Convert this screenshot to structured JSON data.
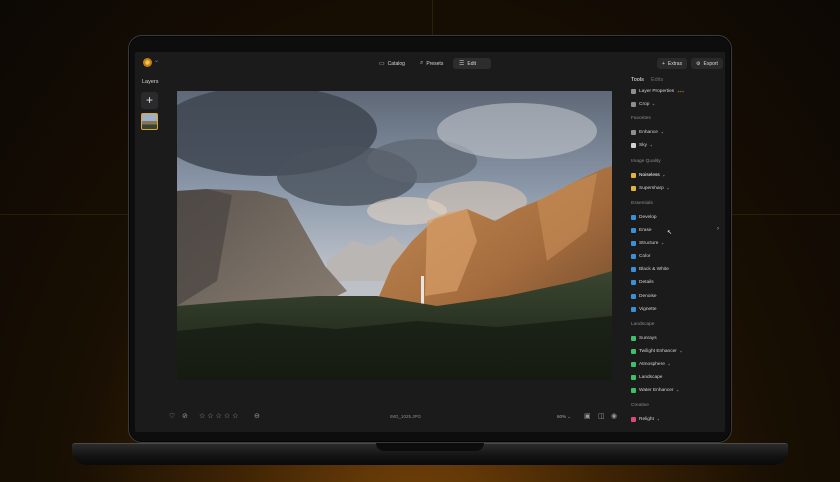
{
  "topbar": {
    "modes": [
      {
        "label": "Catalog",
        "icon": "catalog-icon"
      },
      {
        "label": "Presets",
        "icon": "presets-icon"
      },
      {
        "label": "Edit",
        "icon": "edit-icon",
        "active": true
      }
    ],
    "extras_label": "Extras",
    "export_label": "Export"
  },
  "layers": {
    "title": "Layers"
  },
  "bottombar": {
    "filename": "IMG_1025.JPG",
    "zoom": "60%",
    "rating_stars": 5
  },
  "right_panel": {
    "tabs": [
      "Tools",
      "Edits"
    ],
    "active_tab": "Tools",
    "top_tools": [
      {
        "label": "Layer Properties",
        "badge": "+++",
        "color": "#8e8e8e"
      },
      {
        "label": "Crop",
        "badge": "+",
        "color": "#8e8e8e"
      }
    ],
    "sections": [
      {
        "title": "Favorites",
        "tools": [
          {
            "label": "Enhance",
            "badge": "+",
            "color": "#8e8e8e"
          },
          {
            "label": "Sky",
            "badge": "+",
            "color": "#d0d0d0"
          }
        ]
      },
      {
        "title": "Image Quality",
        "tools": [
          {
            "label": "Noiseless",
            "badge": "+",
            "color": "#e0b43a",
            "selected": true
          },
          {
            "label": "Supersharp",
            "badge": "+",
            "color": "#e0b43a"
          }
        ]
      },
      {
        "title": "Essentials",
        "tools": [
          {
            "label": "Develop",
            "badge": "",
            "color": "#3b8fd8"
          },
          {
            "label": "Erase",
            "badge": "",
            "color": "#3b8fd8"
          },
          {
            "label": "Structure",
            "badge": "+",
            "color": "#3b8fd8"
          },
          {
            "label": "Color",
            "badge": "",
            "color": "#3b8fd8"
          },
          {
            "label": "Black & White",
            "badge": "",
            "color": "#3b8fd8"
          },
          {
            "label": "Details",
            "badge": "",
            "color": "#3b8fd8"
          },
          {
            "label": "Denoise",
            "badge": "",
            "color": "#3b8fd8"
          },
          {
            "label": "Vignette",
            "badge": "",
            "color": "#3b8fd8"
          }
        ]
      },
      {
        "title": "Landscape",
        "tools": [
          {
            "label": "Sunrays",
            "badge": "",
            "color": "#3fbf6a"
          },
          {
            "label": "Twilight Enhancer",
            "badge": "+",
            "color": "#3fbf6a"
          },
          {
            "label": "Atmosphere",
            "badge": "+",
            "color": "#3fbf6a"
          },
          {
            "label": "Landscape",
            "badge": "",
            "color": "#3fbf6a"
          },
          {
            "label": "Water Enhancer",
            "badge": "+",
            "color": "#3fbf6a"
          }
        ]
      },
      {
        "title": "Creative",
        "tools": [
          {
            "label": "Relight",
            "badge": "+",
            "color": "#d84a7a"
          }
        ]
      }
    ]
  },
  "colors": {
    "accent": "#e0a53a",
    "panel_bg": "#1b1b1c"
  }
}
